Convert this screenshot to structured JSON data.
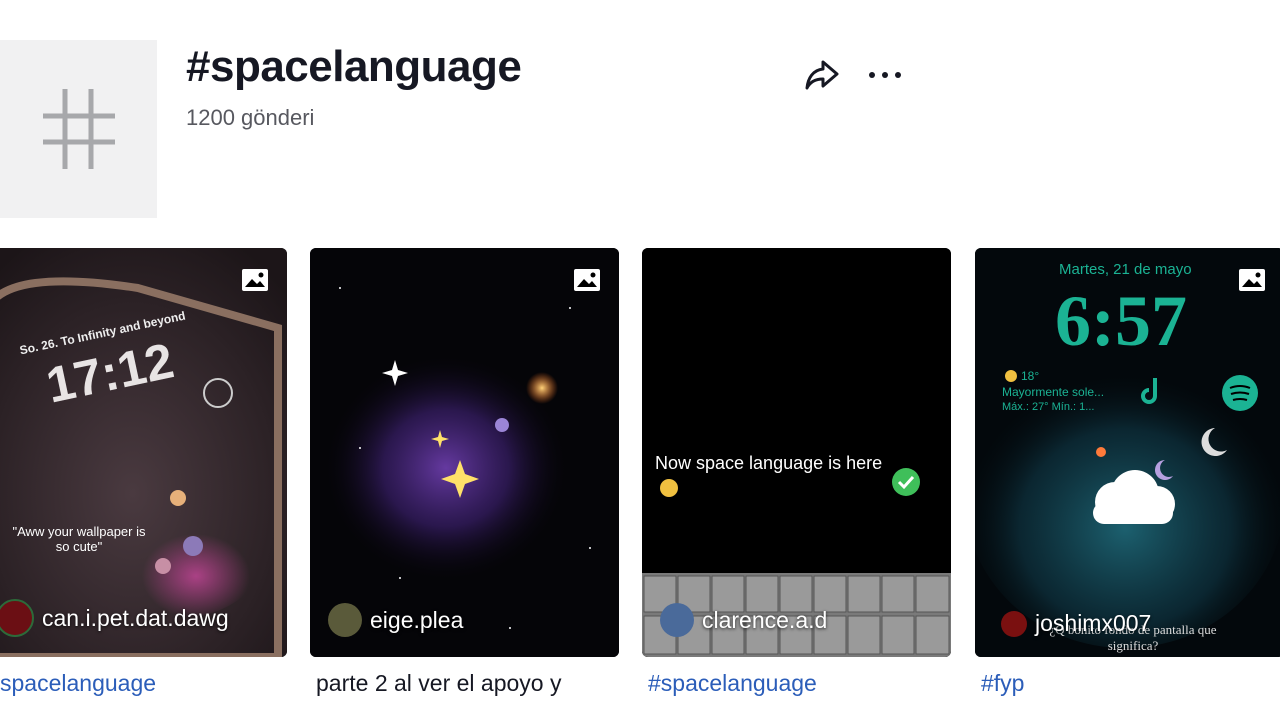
{
  "header": {
    "title": "#spacelanguage",
    "post_count": "1200 gönderi",
    "hash_symbol": "#"
  },
  "icons": {
    "share": "share-arrow-icon",
    "more": "more-dots-icon",
    "photo": "photo-icon"
  },
  "colors": {
    "link": "#2b5db9",
    "teal": "#1bb394"
  },
  "cards": [
    {
      "username": "can.i.pet.dat.dawg",
      "caption": "spacelanguage",
      "overlay": {
        "greeting": "So. 26.  To Infinity and beyond",
        "time": "17:12",
        "quote": "\"Aww your wallpaper is so cute\""
      }
    },
    {
      "username": "eige.plea",
      "caption": "parte 2 al ver el apoyo y"
    },
    {
      "username": "clarence.a.d",
      "caption": "#spacelanguage",
      "overlay": {
        "text": "Now space language is here"
      }
    },
    {
      "username": "joshimx007",
      "caption": "#fyp",
      "overlay": {
        "date": "Martes, 21 de mayo",
        "time": "6:57",
        "temp": "18°",
        "weather": "Mayormente sole...",
        "minmax": "Máx.: 27° Mín.: 1...",
        "subtitle": "¿Q bonito fondo de pantalla que significa?"
      }
    }
  ]
}
